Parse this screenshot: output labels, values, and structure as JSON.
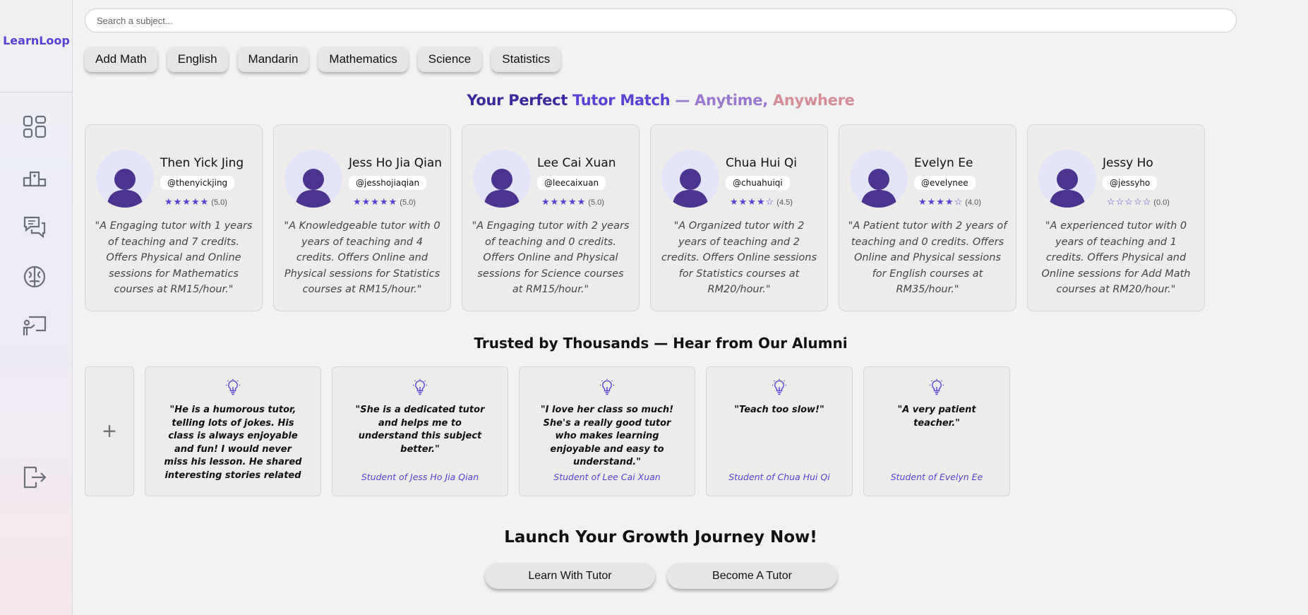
{
  "app": {
    "name": "LearnLoop"
  },
  "sidebar": {
    "items": [
      {
        "icon": "dashboard-icon"
      },
      {
        "icon": "leaderboard-icon"
      },
      {
        "icon": "chat-icon"
      },
      {
        "icon": "brain-icon"
      },
      {
        "icon": "tutor-board-icon"
      }
    ],
    "logout_icon": "logout-icon"
  },
  "search": {
    "placeholder": "Search a subject..."
  },
  "subjects": [
    "Add Math",
    "English",
    "Mandarin",
    "Mathematics",
    "Science",
    "Statistics"
  ],
  "headline": {
    "part1": "Your Perfect",
    "part2": "Tutor Match",
    "part3": "— Anytime,",
    "part4": "Anywhere"
  },
  "colors": {
    "accent": "#5a3fd6",
    "headline_dark": "#3b2a9e",
    "headline_light": "#9a78d0",
    "headline_pink": "#d48c96"
  },
  "tutors": [
    {
      "name": "Then Yick Jing",
      "handle": "@thenyickjing",
      "stars": "★★★★★",
      "rating": "(5.0)",
      "description": "\"A Engaging tutor with 1 years of teaching and 7 credits. Offers Physical and Online sessions for Mathematics courses at RM15/hour.\""
    },
    {
      "name": "Jess Ho Jia Qian",
      "handle": "@jesshojiaqian",
      "stars": "★★★★★",
      "rating": "(5.0)",
      "description": "\"A Knowledgeable tutor with 0 years of teaching and 4 credits. Offers Online and Physical sessions for Statistics courses at RM15/hour.\""
    },
    {
      "name": "Lee Cai Xuan",
      "handle": "@leecaixuan",
      "stars": "★★★★★",
      "rating": "(5.0)",
      "description": "\"A Engaging tutor with 2 years of teaching and 0 credits. Offers Online and Physical sessions for Science courses at RM15/hour.\""
    },
    {
      "name": "Chua Hui Qi",
      "handle": "@chuahuiqi",
      "stars": "★★★★☆",
      "rating": "(4.5)",
      "description": "\"A Organized tutor with 2 years of teaching and 2 credits. Offers Online sessions for Statistics courses at RM20/hour.\""
    },
    {
      "name": "Evelyn Ee",
      "handle": "@evelynee",
      "stars": "★★★★☆",
      "rating": "(4.0)",
      "description": "\"A Patient tutor with 2 years of teaching and 0 credits. Offers Online and Physical sessions for English courses at RM35/hour.\""
    },
    {
      "name": "Jessy Ho",
      "handle": "@jessyho",
      "stars": "☆☆☆☆☆",
      "rating": "(0.0)",
      "description": "\"A experienced tutor with 0 years of teaching and 1 credits. Offers Physical and Online sessions for Add Math courses at RM20/hour.\""
    }
  ],
  "alumni": {
    "title": "Trusted by Thousands — Hear from Our Alumni",
    "add_label": "+",
    "reviews": [
      {
        "quote": "\"He is a humorous tutor, telling lots of jokes. His class is always enjoyable and fun! I would never miss his lesson. He shared interesting stories related to the lesson, making you understand the subject better.\"",
        "by": ""
      },
      {
        "quote": "\"She is a dedicated tutor and helps me to understand this subject better.\"",
        "by": "Student of Jess Ho Jia Qian"
      },
      {
        "quote": "\"I love her class so much! She's a really good tutor who makes learning enjoyable and easy to understand.\"",
        "by": "Student of Lee Cai Xuan"
      },
      {
        "quote": "\"Teach too slow!\"",
        "by": "Student of Chua Hui Qi"
      },
      {
        "quote": "\"A very patient teacher.\"",
        "by": "Student of Evelyn Ee"
      }
    ]
  },
  "cta": {
    "title": "Launch Your Growth Journey Now!",
    "learn_label": "Learn With Tutor",
    "become_label": "Become A Tutor"
  }
}
